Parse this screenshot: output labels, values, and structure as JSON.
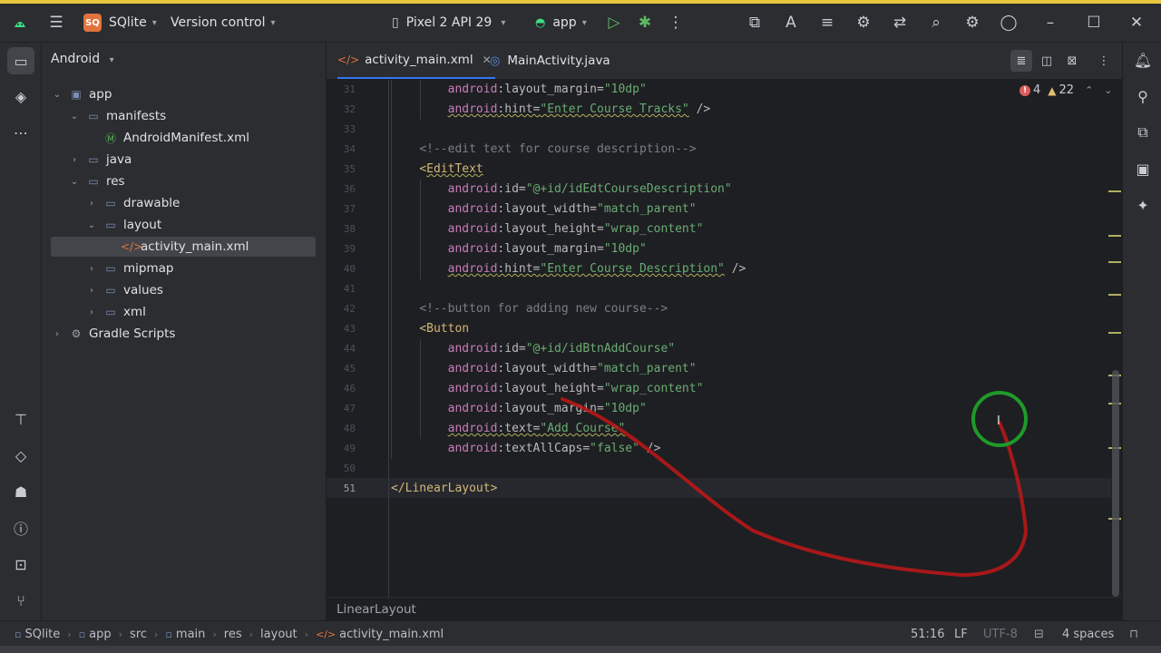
{
  "window": {
    "project_badge": "SQ",
    "project_name": "SQlite",
    "vcs": "Version control",
    "device": "Pixel 2 API 29",
    "run_config": "app"
  },
  "sidebar": {
    "view": "Android",
    "tree": [
      {
        "label": "app",
        "depth": 0,
        "arrow": "expanded",
        "icon": "folder-module-icon"
      },
      {
        "label": "manifests",
        "depth": 1,
        "arrow": "expanded",
        "icon": "folder-icon"
      },
      {
        "label": "AndroidManifest.xml",
        "depth": 2,
        "arrow": "none",
        "icon": "manifest-icon"
      },
      {
        "label": "java",
        "depth": 1,
        "arrow": "collapsed",
        "icon": "folder-icon"
      },
      {
        "label": "res",
        "depth": 1,
        "arrow": "expanded",
        "icon": "folder-icon"
      },
      {
        "label": "drawable",
        "depth": 2,
        "arrow": "collapsed",
        "icon": "folder-icon"
      },
      {
        "label": "layout",
        "depth": 2,
        "arrow": "expanded",
        "icon": "folder-icon"
      },
      {
        "label": "activity_main.xml",
        "depth": 3,
        "arrow": "none",
        "icon": "xml-file-icon",
        "selected": true
      },
      {
        "label": "mipmap",
        "depth": 2,
        "arrow": "collapsed",
        "icon": "folder-icon"
      },
      {
        "label": "values",
        "depth": 2,
        "arrow": "collapsed",
        "icon": "folder-icon"
      },
      {
        "label": "xml",
        "depth": 2,
        "arrow": "collapsed",
        "icon": "folder-icon"
      },
      {
        "label": "Gradle Scripts",
        "depth": 0,
        "arrow": "collapsed",
        "icon": "gradle-icon"
      }
    ]
  },
  "tabs": [
    {
      "label": "activity_main.xml",
      "active": true,
      "icon": "xml-file-icon"
    },
    {
      "label": "MainActivity.java",
      "active": false,
      "icon": "java-class-icon"
    }
  ],
  "inspections": {
    "errors": "4",
    "warnings": "22"
  },
  "editor": {
    "current_line": 51,
    "lines": [
      {
        "n": 31,
        "tokens": [
          [
            "indent2",
            ""
          ],
          [
            "ns",
            "android"
          ],
          [
            "attr",
            ":layout_margin="
          ],
          [
            "val",
            "\"10dp\""
          ]
        ]
      },
      {
        "n": 32,
        "tokens": [
          [
            "indent2",
            ""
          ],
          [
            "ns squig",
            "android"
          ],
          [
            "attr squig",
            ":hint="
          ],
          [
            "val squig",
            "\"Enter Course Tracks\""
          ],
          [
            "attr",
            " />"
          ]
        ]
      },
      {
        "n": 33,
        "tokens": []
      },
      {
        "n": 34,
        "tokens": [
          [
            "indent1",
            ""
          ],
          [
            "cmt",
            "<!--edit text for course description-->"
          ]
        ]
      },
      {
        "n": 35,
        "tokens": [
          [
            "indent1",
            ""
          ],
          [
            "tag",
            "<"
          ],
          [
            "tag squig",
            "EditText"
          ]
        ]
      },
      {
        "n": 36,
        "tokens": [
          [
            "indent2",
            ""
          ],
          [
            "ns",
            "android"
          ],
          [
            "attr",
            ":id="
          ],
          [
            "val",
            "\"@+id/idEdtCourseDescription\""
          ]
        ]
      },
      {
        "n": 37,
        "tokens": [
          [
            "indent2",
            ""
          ],
          [
            "ns",
            "android"
          ],
          [
            "attr",
            ":layout_width="
          ],
          [
            "val",
            "\"match_parent\""
          ]
        ]
      },
      {
        "n": 38,
        "tokens": [
          [
            "indent2",
            ""
          ],
          [
            "ns",
            "android"
          ],
          [
            "attr",
            ":layout_height="
          ],
          [
            "val",
            "\"wrap_content\""
          ]
        ]
      },
      {
        "n": 39,
        "tokens": [
          [
            "indent2",
            ""
          ],
          [
            "ns",
            "android"
          ],
          [
            "attr",
            ":layout_margin="
          ],
          [
            "val",
            "\"10dp\""
          ]
        ]
      },
      {
        "n": 40,
        "tokens": [
          [
            "indent2",
            ""
          ],
          [
            "ns squig",
            "android"
          ],
          [
            "attr squig",
            ":hint="
          ],
          [
            "val squig",
            "\"Enter Course Description\""
          ],
          [
            "attr",
            " />"
          ]
        ]
      },
      {
        "n": 41,
        "tokens": []
      },
      {
        "n": 42,
        "tokens": [
          [
            "indent1",
            ""
          ],
          [
            "cmt",
            "<!--button for adding new course-->"
          ]
        ]
      },
      {
        "n": 43,
        "tokens": [
          [
            "indent1",
            ""
          ],
          [
            "tag",
            "<Button"
          ]
        ]
      },
      {
        "n": 44,
        "tokens": [
          [
            "indent2",
            ""
          ],
          [
            "ns",
            "android"
          ],
          [
            "attr",
            ":id="
          ],
          [
            "val",
            "\"@+id/idBtnAddCourse\""
          ]
        ]
      },
      {
        "n": 45,
        "tokens": [
          [
            "indent2",
            ""
          ],
          [
            "ns",
            "android"
          ],
          [
            "attr",
            ":layout_width="
          ],
          [
            "val",
            "\"match_parent\""
          ]
        ]
      },
      {
        "n": 46,
        "tokens": [
          [
            "indent2",
            ""
          ],
          [
            "ns",
            "android"
          ],
          [
            "attr",
            ":layout_height="
          ],
          [
            "val",
            "\"wrap_content\""
          ]
        ]
      },
      {
        "n": 47,
        "tokens": [
          [
            "indent2",
            ""
          ],
          [
            "ns",
            "android"
          ],
          [
            "attr",
            ":layout_margin="
          ],
          [
            "val",
            "\"10dp\""
          ]
        ]
      },
      {
        "n": 48,
        "tokens": [
          [
            "indent2",
            ""
          ],
          [
            "ns squig",
            "android"
          ],
          [
            "attr squig",
            ":text="
          ],
          [
            "val squig",
            "\"Add Course\""
          ]
        ]
      },
      {
        "n": 49,
        "tokens": [
          [
            "indent2",
            ""
          ],
          [
            "ns",
            "android"
          ],
          [
            "attr",
            ":textAllCaps="
          ],
          [
            "val",
            "\"false\""
          ],
          [
            "attr",
            " />"
          ]
        ]
      },
      {
        "n": 50,
        "tokens": []
      },
      {
        "n": 51,
        "tokens": [
          [
            "tag",
            "</LinearLayout>"
          ]
        ]
      }
    ]
  },
  "editor_breadcrumb": "LinearLayout",
  "statusbar": {
    "path": [
      "SQlite",
      "app",
      "src",
      "main",
      "res",
      "layout",
      "activity_main.xml"
    ],
    "position": "51:16",
    "line_sep": "LF",
    "encoding": "UTF-8",
    "indent": "4 spaces"
  },
  "colors": {
    "accent": "#3574f0",
    "error": "#db5c5c",
    "warning": "#e0c070",
    "annotation_stroke": "#c01818",
    "annotation_circle": "#1f9a2a"
  }
}
